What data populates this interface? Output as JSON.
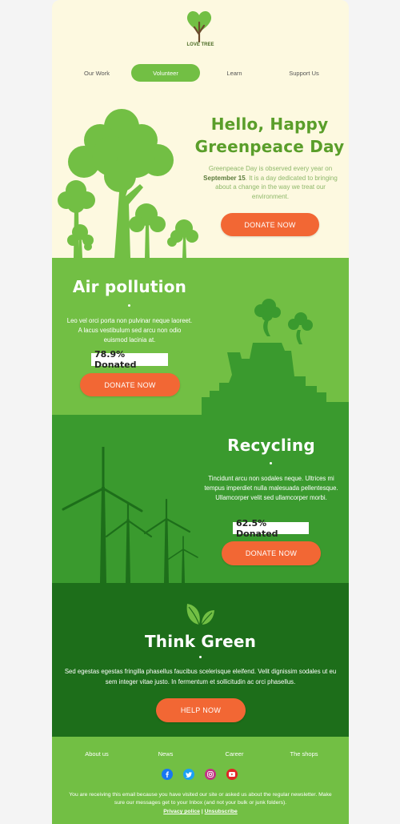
{
  "brand": {
    "logo_text": "LOVE TREE"
  },
  "nav": {
    "items": [
      "Our Work",
      "Volunteer",
      "Learn",
      "Support Us"
    ]
  },
  "hero": {
    "title_line1": "Hello, Happy",
    "title_line2": "Greenpeace Day",
    "body_pre": "Greenpeace Day is observed every year on ",
    "body_bold": "September 15",
    "body_post": ". It is a day dedicated to bringing about a change in the way we treat our environment.",
    "button": "DONATE NOW"
  },
  "air": {
    "title": "Air pollution",
    "body": "Leo vel orci porta non pulvinar neque laoreet. A lacus vestibulum sed arcu non odio euismod lacinia at.",
    "donated": "78.9% Donated",
    "donated_fraction": 0.789,
    "button": "DONATE NOW"
  },
  "recycling": {
    "title": "Recycling",
    "body": "Tincidunt arcu non sodales neque. Ultrices mi tempus imperdiet nulla malesuada pellentesque. Ullamcorper velit sed ullamcorper morbi.",
    "donated": "62.5% Donated",
    "donated_fraction": 0.625,
    "button": "DONATE NOW"
  },
  "think": {
    "title": "Think Green",
    "body": "Sed egestas egestas fringilla phasellus faucibus scelerisque eleifend. Velit dignissim sodales ut eu sem integer vitae justo. In fermentum et sollicitudin ac orci phasellus.",
    "button": "HELP NOW"
  },
  "footer": {
    "links": [
      "About us",
      "News",
      "Career",
      "The shops"
    ],
    "social": [
      "facebook-icon",
      "twitter-icon",
      "instagram-icon",
      "youtube-icon"
    ],
    "notice": "You are receiving this email because you have visited our site or asked us about the regular newsletter. Make sure our messages get to your Inbox (and not your bulk or junk folders).",
    "privacy": "Privacy police",
    "separator": " | ",
    "unsubscribe": "Unsubscribe"
  },
  "colors": {
    "cream": "#fdf9e0",
    "light_green": "#72bf44",
    "mid_green": "#3a9a2e",
    "dark_green": "#1d6e1a",
    "orange": "#f26734",
    "title_green": "#5a9e2a"
  }
}
